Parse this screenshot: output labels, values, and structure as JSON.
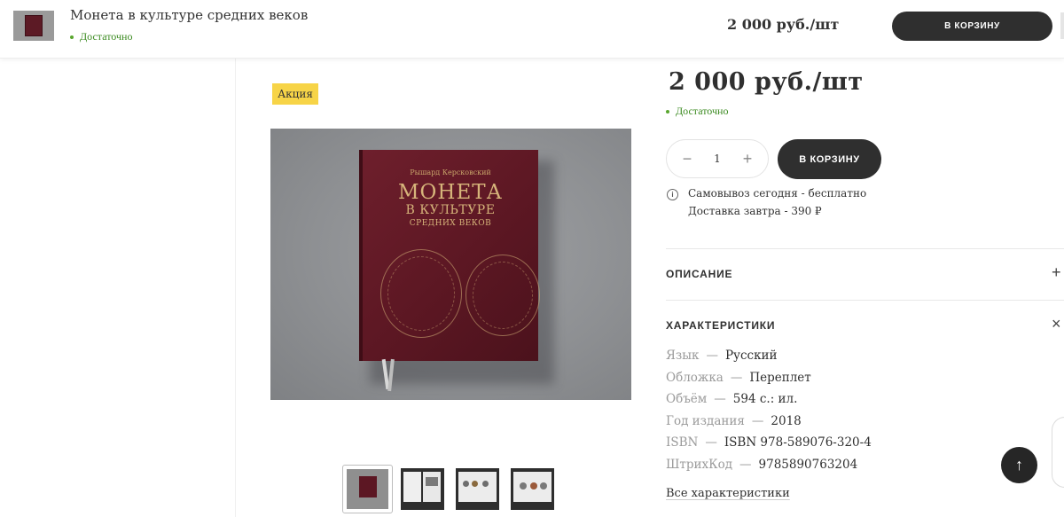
{
  "sticky_bar": {
    "title": "Монета в культуре средних веков",
    "availability": "Достаточно",
    "price": "2 000 руб./шт",
    "cart_button": "В КОРЗИНУ"
  },
  "product": {
    "badge": "Акция",
    "cover": {
      "author": "Рышард Керсковский",
      "title_line1": "МОНЕТА",
      "title_line2": "В КУЛЬТУРЕ",
      "title_line3": "СРЕДНИХ ВЕКОВ"
    },
    "thumbnails": [
      {
        "name": "cover"
      },
      {
        "name": "spread-1"
      },
      {
        "name": "spread-2"
      },
      {
        "name": "spread-3"
      }
    ]
  },
  "purchase": {
    "price": "2 000 руб./шт",
    "availability": "Достаточно",
    "quantity": "1",
    "minus": "−",
    "plus": "+",
    "cart_button": "В КОРЗИНУ",
    "pickup": "Самовывоз сегодня - бесплатно",
    "delivery": "Доставка завтра - 390 ₽",
    "info_icon": "i"
  },
  "accordion": {
    "description": {
      "title": "ОПИСАНИЕ",
      "icon": "+"
    },
    "characteristics": {
      "title": "ХАРАКТЕРИСТИКИ",
      "icon": "×"
    }
  },
  "specs": [
    {
      "key": "Язык",
      "sep": "—",
      "value": "Русский"
    },
    {
      "key": "Обложка",
      "sep": "—",
      "value": "Переплет"
    },
    {
      "key": "Объём",
      "sep": "—",
      "value": "594 с.: ил."
    },
    {
      "key": "Год издания",
      "sep": "—",
      "value": "2018"
    },
    {
      "key": "ISBN",
      "sep": "—",
      "value": "ISBN 978-589076-320-4"
    },
    {
      "key": "ШтрихКод",
      "sep": "—",
      "value": "9785890763204"
    }
  ],
  "all_specs_link": "Все характеристики",
  "scroll_top_icon": "↑",
  "colors": {
    "accent_dark": "#2f2f2f",
    "availability_green": "#3a8a1f",
    "badge_yellow": "#f7d447",
    "book_cover": "#5c1723"
  }
}
